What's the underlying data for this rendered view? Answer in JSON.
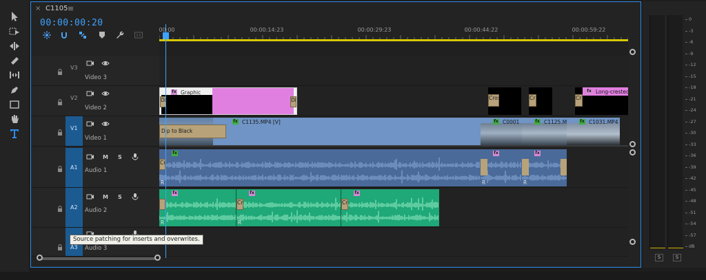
{
  "tab": {
    "close": "×",
    "title": "C1105",
    "menu": "≡"
  },
  "timecode": "00:00:00:20",
  "ruler_ticks": [
    "00:00",
    "00:00:14:23",
    "00:00:29:23",
    "00:00:44:22",
    "00:00:59:22"
  ],
  "tracks": {
    "v3": {
      "id": "V3",
      "name": "Video 3"
    },
    "v2": {
      "id": "V2",
      "name": "Video 2"
    },
    "v1": {
      "id": "V1",
      "name": "Video 1"
    },
    "a1": {
      "id": "A1",
      "name": "Audio 1"
    },
    "a2": {
      "id": "A2",
      "name": "Audio 2"
    },
    "a3": {
      "id": "A3",
      "name": "Audio 3"
    }
  },
  "header_buttons": {
    "mute": "M",
    "solo": "S"
  },
  "clips": {
    "graphic": "Graphic",
    "graphic_di_left": "Di",
    "graphic_di_right": "Di",
    "cros": "Cros",
    "cr2": "Cr",
    "cr3": "Cr",
    "long_crested": "Long-crested",
    "dip_to_black": "Dip to Black",
    "c1135": "C1135.MP4 [V]",
    "c0001": "C0001",
    "c1125": "C1125.M",
    "c1031": "C1031.MP4",
    "cr_audio1": "Cr",
    "r_audio1": "R",
    "r_audio2a": "R",
    "r_audio2b": "R",
    "cr_audio2a": "Cr",
    "r_audio2c": "R",
    "cr_audio2b": "Cr",
    "r_audio2d": "R",
    "cr_audio2c": "Cr",
    "fx": "fx"
  },
  "tooltip": "Source patching for inserts and overwrites.",
  "meter": {
    "db_labels": [
      "0",
      "-3",
      "-6",
      "-9",
      "-12",
      "-15",
      "-18",
      "-21",
      "-24",
      "-27",
      "-30",
      "-33",
      "-36",
      "-39",
      "-42",
      "-45",
      "-48",
      "-51",
      "-54",
      "-57",
      "dB"
    ],
    "solo_left": "S",
    "solo_right": "S"
  },
  "colors": {
    "accent": "#2d8ceb",
    "timecode": "#3da3ff",
    "graphic_clip": "#e07fe0",
    "video_clip": "#6f94c5",
    "audio1_clip": "#4a6a9a",
    "audio2_clip": "#1fa878",
    "work_area": "#d8c700"
  }
}
